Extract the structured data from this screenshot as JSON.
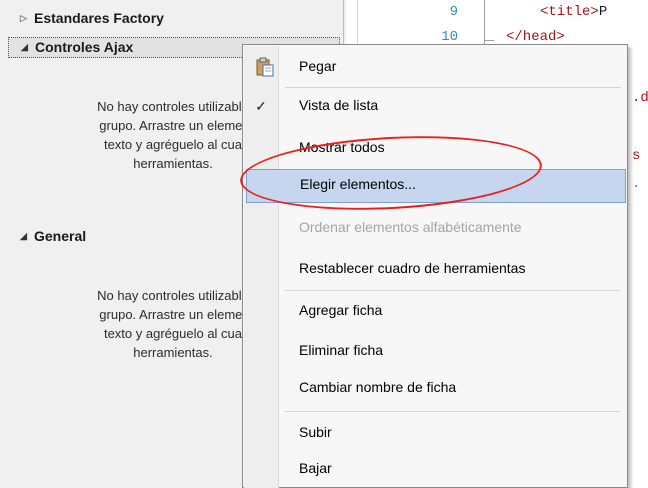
{
  "toolbox": {
    "groups": [
      {
        "title": "Estandares Factory",
        "expanded": false
      },
      {
        "title": "Controles Ajax",
        "expanded": true,
        "empty_lines": [
          "No hay controles utilizable",
          "grupo. Arrastre un elemer",
          "texto y agréguelo al cua",
          "herramientas."
        ]
      },
      {
        "title": "General",
        "expanded": true,
        "empty_lines": [
          "No hay controles utilizable",
          "grupo. Arrastre un elemer",
          "texto y agréguelo al cua",
          "herramientas."
        ]
      }
    ]
  },
  "editor": {
    "lines": [
      {
        "number": "9",
        "indent": "    ",
        "tag": "<title>",
        "text": "P"
      },
      {
        "number": "10",
        "text": "</head>"
      }
    ],
    "fragments": [
      ".d",
      "s",
      "."
    ]
  },
  "context_menu": {
    "items": [
      {
        "label": "Pegar",
        "icon": "paste-icon"
      },
      {
        "label": "Vista de lista",
        "checked": true,
        "icon": "check-icon"
      },
      {
        "label": "Mostrar todos"
      },
      {
        "label": "Elegir elementos...",
        "highlighted": true
      },
      {
        "label": "Ordenar elementos alfabéticamente",
        "disabled": true
      },
      {
        "label": "Restablecer cuadro de herramientas"
      },
      {
        "label": "Agregar ficha"
      },
      {
        "label": "Eliminar ficha"
      },
      {
        "label": "Cambiar nombre de ficha"
      },
      {
        "label": "Subir"
      },
      {
        "label": "Bajar"
      }
    ]
  },
  "colors": {
    "highlight_bg": "#c5d6ee",
    "highlight_border": "#7da2ce",
    "annotation": "#e8211d",
    "line_number": "#2b91af",
    "code_tag": "#a31515"
  }
}
